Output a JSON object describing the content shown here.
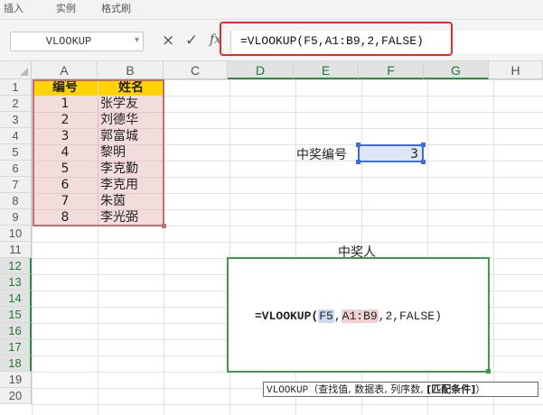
{
  "toolbar_fragments": [
    "插入",
    "实例",
    "格式刷"
  ],
  "name_box": {
    "value": "VLOOKUP"
  },
  "formula_bar": {
    "cancel": "×",
    "confirm": "✓",
    "fx": "fx",
    "formula": "=VLOOKUP(F5,A1:B9,2,FALSE)"
  },
  "columns": [
    "A",
    "B",
    "C",
    "D",
    "E",
    "F",
    "G",
    "H"
  ],
  "rows": [
    "1",
    "2",
    "3",
    "4",
    "5",
    "6",
    "7",
    "8",
    "9",
    "10",
    "11",
    "12",
    "13",
    "14",
    "15",
    "16",
    "17",
    "18",
    "19",
    "20"
  ],
  "table": {
    "header": {
      "id": "编号",
      "name": "姓名"
    },
    "rows": [
      {
        "id": "1",
        "name": "张学友"
      },
      {
        "id": "2",
        "name": "刘德华"
      },
      {
        "id": "3",
        "name": "郭富城"
      },
      {
        "id": "4",
        "name": "黎明"
      },
      {
        "id": "5",
        "name": "李克勤"
      },
      {
        "id": "6",
        "name": "李克用"
      },
      {
        "id": "7",
        "name": "朱茵"
      },
      {
        "id": "8",
        "name": "李光弼"
      }
    ]
  },
  "prize_label": "中奖编号",
  "prize_value": "3",
  "winner_label": "中奖人",
  "edit_formula": {
    "prefix": "=VLOOKUP(",
    "ref1": "F5",
    "comma": ",",
    "ref2": "A1:B9",
    "suffix": ",2,FALSE)"
  },
  "tooltip": {
    "fn": "VLOOKUP",
    "args": "（查找值, 数据表, 列序数, ",
    "current": "[匹配条件]",
    "close": "）"
  },
  "colors": {
    "selection_green": "#3f9b4b",
    "header_yellow": "#ffd400",
    "range_pink": "#f2dcdc",
    "ref_blue": "#3c6ed5",
    "highlight_red": "#e8292b"
  }
}
